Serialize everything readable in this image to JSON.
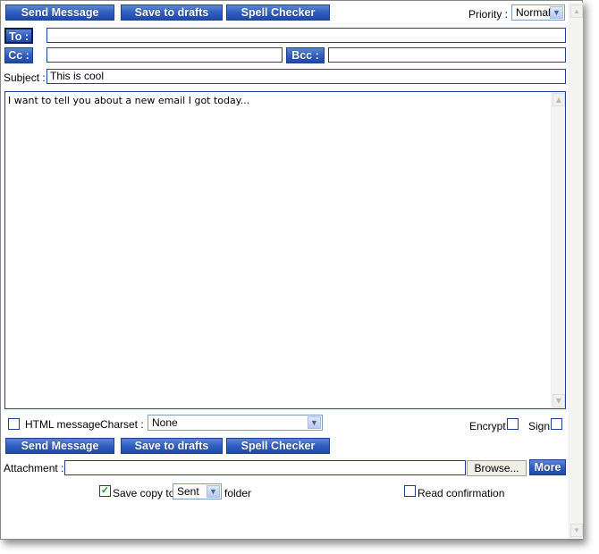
{
  "toolbar": {
    "send": "Send Message",
    "drafts": "Save to drafts",
    "spell": "Spell Checker"
  },
  "priority": {
    "label": "Priority :",
    "value": "Normal"
  },
  "to": {
    "label": "To :",
    "value": ""
  },
  "cc": {
    "label": "Cc :",
    "value": ""
  },
  "bcc": {
    "label": "Bcc :",
    "value": ""
  },
  "subject": {
    "label": "Subject :",
    "value": "This is cool"
  },
  "body": {
    "value": "I want to tell you about a new email I got today..."
  },
  "options": {
    "html_label": "HTML message",
    "html_checked": false,
    "charset_label": "Charset :",
    "charset_value": "None",
    "encrypt_label": "Encrypt",
    "encrypt_checked": false,
    "sign_label": "Sign",
    "sign_checked": false
  },
  "attachment": {
    "label": "Attachment :",
    "value": "",
    "browse": "Browse...",
    "more": "More"
  },
  "save_copy": {
    "checked": true,
    "label": "Save copy to",
    "folder_value": "Sent",
    "suffix": "folder"
  },
  "read_confirmation": {
    "checked": false,
    "label": "Read confirmation"
  },
  "icons": {
    "check": "✓",
    "chevron": "▼",
    "up": "▲",
    "down": "▼"
  },
  "colors": {
    "button": "#2d5bbf",
    "border": "#1e3f99"
  }
}
